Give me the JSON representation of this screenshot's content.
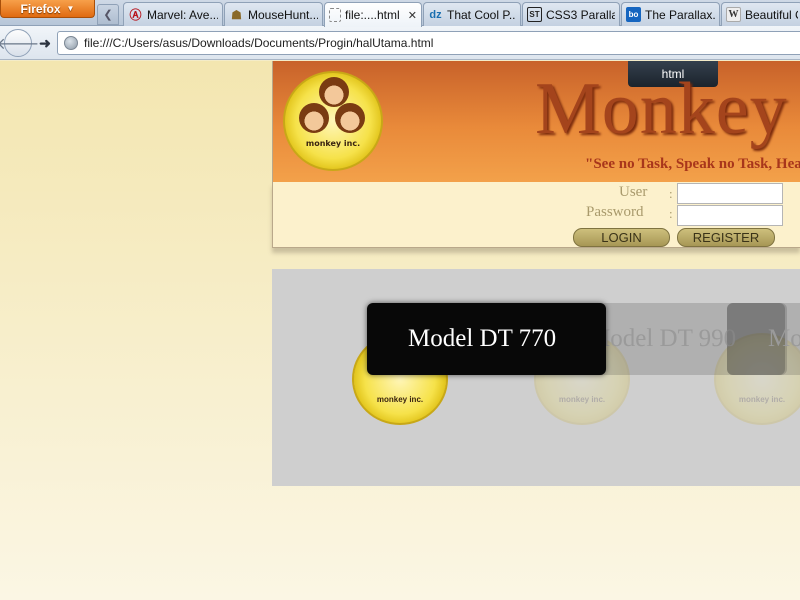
{
  "browser": {
    "app_button": "Firefox",
    "tabs": [
      {
        "label": "Marvel: Ave...",
        "icon": "avengers-icon"
      },
      {
        "label": "MouseHunt...",
        "icon": "mousehunt-icon"
      },
      {
        "label": "file:....html",
        "icon": "blank-page-icon",
        "active": true
      },
      {
        "label": "That Cool P...",
        "icon": "dzone-icon",
        "fav_text": "dz"
      },
      {
        "label": "CSS3 Paralla...",
        "icon": "st-icon",
        "fav_text": "ST"
      },
      {
        "label": "The Parallax...",
        "icon": "bo-icon",
        "fav_text": "bo"
      },
      {
        "label": "Beautiful C",
        "icon": "wiki-icon",
        "fav_text": "W"
      }
    ],
    "url": "file:///C:/Users/asus/Downloads/Documents/Progin/halUtama.html"
  },
  "page": {
    "badge": "html",
    "title": "Monkey",
    "tagline": "\"See no Task, Speak no Task, Hea",
    "logo_text": "monkey inc.",
    "login": {
      "user_label": "User",
      "password_label": "Password",
      "colon": ":",
      "user_value": "",
      "password_value": "",
      "login_button": "LOGIN",
      "register_button": "REGISTER"
    },
    "slides": [
      {
        "label": "Model DT 770"
      },
      {
        "label": "Model DT 990"
      },
      {
        "label": "Mo"
      }
    ]
  },
  "colors": {
    "header_orange": "#e98a3a",
    "title_brown": "#a4441c",
    "login_bg": "#fcf1cc",
    "button_khaki": "#b9a96a",
    "slider_gray": "#cfcfcf"
  }
}
